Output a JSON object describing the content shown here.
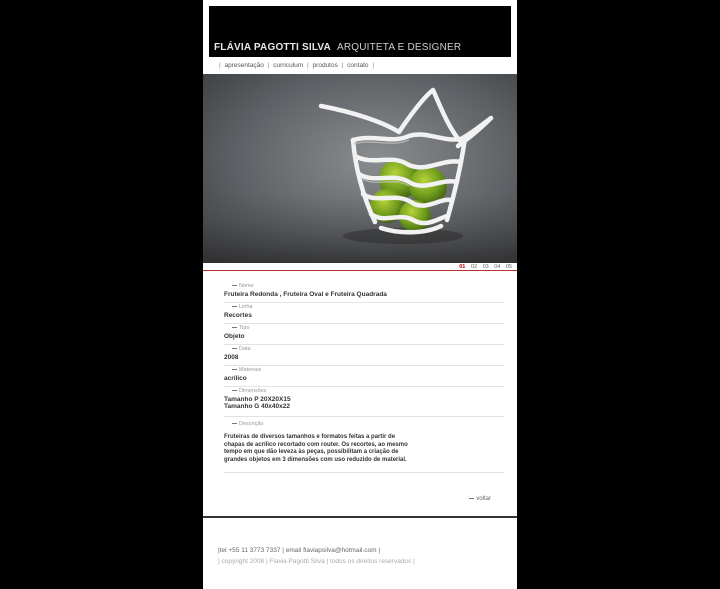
{
  "header": {
    "name": "FLÁVIA PAGOTTI SILVA",
    "subtitle": "ARQUITETA E DESIGNER"
  },
  "nav": {
    "items": [
      {
        "label": "apresentação"
      },
      {
        "label": "curriculum"
      },
      {
        "label": "produtos"
      },
      {
        "label": "contato"
      }
    ],
    "separator": "|"
  },
  "gallery": {
    "pages": [
      "01",
      "02",
      "03",
      "04",
      "05"
    ],
    "active": "01",
    "image_icon": "product-photo-fruit-bowl"
  },
  "details": {
    "nome": {
      "label": "Nome",
      "value": "Fruteira Redonda , Fruteira Oval e Fruteira Quadrada"
    },
    "linha": {
      "label": "Linha",
      "value": "Recortes"
    },
    "tipo": {
      "label": "Tipo",
      "value": "Objeto"
    },
    "data": {
      "label": "Data",
      "value": "2008"
    },
    "materiais": {
      "label": "Materiais",
      "value": "acrílico"
    },
    "dimensoes": {
      "label": "Dimensões",
      "value": "Tamanho P 20X20X15\nTamanho G 40x40x22"
    },
    "descricao": {
      "label": "Descrição",
      "value": "Fruteiras de diversos tamanhos e formatos feitas a partir de chapas de acrílico recortado com router. Os recortes, ao mesmo tempo em que dão leveza às peças, possibilitam a criação de grandes objetos em 3 dimensões com uso reduzido de material."
    }
  },
  "back": {
    "label": "voltar"
  },
  "footer": {
    "contact": "|tel +55 11 3773 7337 | email flaviapsilva@hotmail.com |",
    "copyright": "| copyright 2008 | Flavia Pagotti Silva | todos os direitos reservados |"
  },
  "colors": {
    "background": "#000000",
    "accent_red": "#b30000",
    "text": "#333333"
  }
}
